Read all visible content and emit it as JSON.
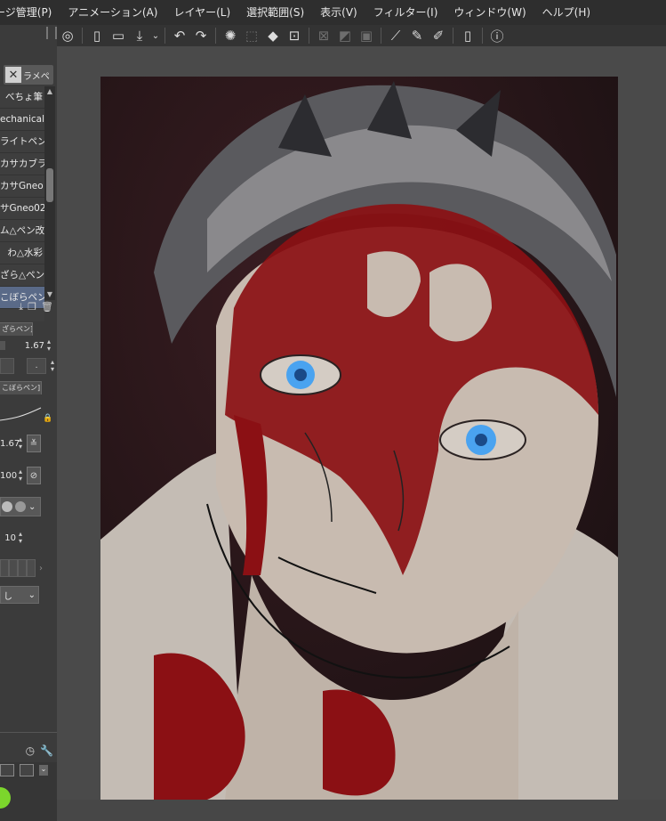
{
  "menu": {
    "items": [
      "ージ管理(P)",
      "アニメーション(A)",
      "レイヤー(L)",
      "選択範囲(S)",
      "表示(V)",
      "フィルター(I)",
      "ウィンドウ(W)",
      "ヘルプ(H)"
    ]
  },
  "toolbar": {
    "icons": [
      "clip-studio-icon",
      "new-file-icon",
      "open-file-icon",
      "save-icon",
      "dropdown-icon",
      "undo-icon",
      "redo-icon",
      "loading-icon",
      "selection-icon",
      "fill-icon",
      "transform-icon",
      "clear-outside-icon",
      "fill-selection-icon",
      "invert-icon",
      "show-selection-icon",
      "ruler-icon",
      "pen-icon",
      "brush-icon",
      "smartphone-icon",
      "help-icon"
    ]
  },
  "subtool": {
    "group_label": "ラメペ",
    "brushes": [
      "べちょ筆",
      "echanical",
      "ライトペン",
      "カサカブラ",
      "カサGneo",
      "サGneo02",
      "ム△ペン改",
      "わ△水彩",
      "ざら△ペン",
      "こぼらペン"
    ],
    "selected_index": 9
  },
  "tool_property": {
    "tab_label": "ざらペン]",
    "size_value": "1.67"
  },
  "brush_size_panel": {
    "tab_label": "こぼらペン]",
    "size_value": "1.67",
    "opacity_value": "100",
    "value_10": "10",
    "dropdown_value": "し"
  }
}
